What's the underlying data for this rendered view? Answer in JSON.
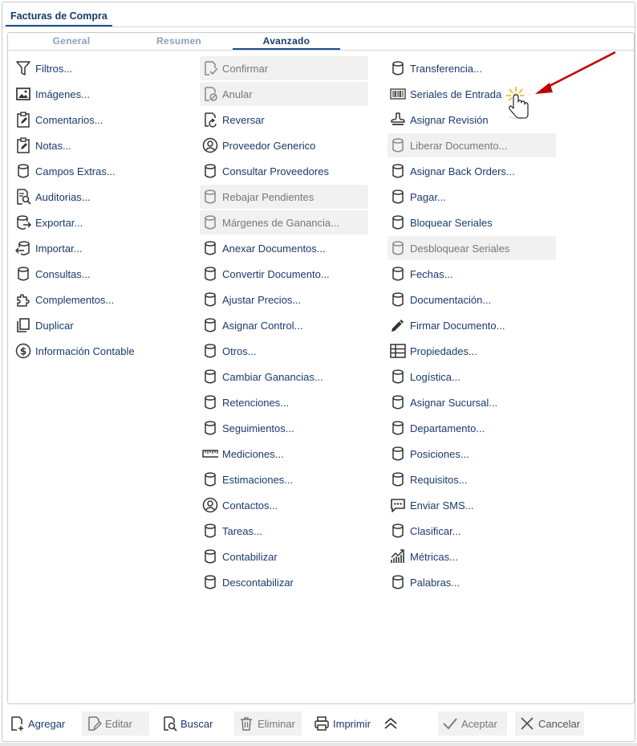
{
  "window": {
    "title": "Facturas de Compra"
  },
  "tabs": [
    {
      "label": "General",
      "active": false
    },
    {
      "label": "Resumen",
      "active": false
    },
    {
      "label": "Avanzado",
      "active": true
    }
  ],
  "col1": [
    {
      "label": "Filtros...",
      "icon": "filter-icon"
    },
    {
      "label": "Imágenes...",
      "icon": "image-icon"
    },
    {
      "label": "Comentarios...",
      "icon": "clipboard-edit-icon"
    },
    {
      "label": "Notas...",
      "icon": "clipboard-edit-icon"
    },
    {
      "label": "Campos Extras...",
      "icon": "database-icon"
    },
    {
      "label": "Auditorias...",
      "icon": "audit-search-icon"
    },
    {
      "label": "Exportar...",
      "icon": "database-export-icon"
    },
    {
      "label": "Importar...",
      "icon": "database-import-icon"
    },
    {
      "label": "Consultas...",
      "icon": "database-icon"
    },
    {
      "label": "Complementos...",
      "icon": "puzzle-icon"
    },
    {
      "label": "Duplicar",
      "icon": "copy-icon"
    },
    {
      "label": "Información Contable",
      "icon": "dollar-circle-icon"
    }
  ],
  "col2": [
    {
      "label": "Confirmar",
      "icon": "doc-check-icon",
      "disabled": true
    },
    {
      "label": "Anular",
      "icon": "doc-cancel-icon",
      "disabled": true
    },
    {
      "label": "Reversar",
      "icon": "doc-reverse-icon"
    },
    {
      "label": "Proveedor Generico",
      "icon": "user-circle-icon"
    },
    {
      "label": "Consultar Proveedores",
      "icon": "database-icon"
    },
    {
      "label": "Rebajar Pendientes",
      "icon": "database-icon",
      "disabled": true
    },
    {
      "label": "Márgenes de Ganancia...",
      "icon": "database-icon",
      "disabled": true
    },
    {
      "label": "Anexar Documentos...",
      "icon": "database-icon"
    },
    {
      "label": "Convertir Documento...",
      "icon": "database-icon"
    },
    {
      "label": "Ajustar Precios...",
      "icon": "database-icon"
    },
    {
      "label": "Asignar Control...",
      "icon": "database-icon"
    },
    {
      "label": "Otros...",
      "icon": "database-icon"
    },
    {
      "label": "Cambiar Ganancias...",
      "icon": "database-icon"
    },
    {
      "label": "Retenciones...",
      "icon": "database-icon"
    },
    {
      "label": "Seguimientos...",
      "icon": "database-icon"
    },
    {
      "label": "Mediciones...",
      "icon": "ruler-icon"
    },
    {
      "label": "Estimaciones...",
      "icon": "database-icon"
    },
    {
      "label": "Contactos...",
      "icon": "user-circle-icon"
    },
    {
      "label": "Tareas...",
      "icon": "database-icon"
    },
    {
      "label": "Contabilizar",
      "icon": "database-icon"
    },
    {
      "label": "Descontabilizar",
      "icon": "database-icon"
    }
  ],
  "col3": [
    {
      "label": "Transferencia...",
      "icon": "database-icon"
    },
    {
      "label": "Seriales de Entrada",
      "icon": "barcode-icon"
    },
    {
      "label": "Asignar Revisión",
      "icon": "stamp-icon"
    },
    {
      "label": "Liberar Documento...",
      "icon": "database-icon",
      "disabled": true
    },
    {
      "label": "Asignar Back Orders...",
      "icon": "database-icon"
    },
    {
      "label": "Pagar...",
      "icon": "database-icon"
    },
    {
      "label": "Bloquear Seriales",
      "icon": "database-icon"
    },
    {
      "label": "Desbloquear Seriales",
      "icon": "database-icon",
      "disabled": true
    },
    {
      "label": "Fechas...",
      "icon": "database-icon"
    },
    {
      "label": "Documentación...",
      "icon": "database-icon"
    },
    {
      "label": "Firmar Documento...",
      "icon": "pen-icon"
    },
    {
      "label": "Propiedades...",
      "icon": "properties-icon"
    },
    {
      "label": "Logística...",
      "icon": "database-icon"
    },
    {
      "label": "Asignar Sucursal...",
      "icon": "database-icon"
    },
    {
      "label": "Departamento...",
      "icon": "database-icon"
    },
    {
      "label": "Posiciones...",
      "icon": "database-icon"
    },
    {
      "label": "Requisitos...",
      "icon": "database-icon"
    },
    {
      "label": "Enviar SMS...",
      "icon": "chat-icon"
    },
    {
      "label": "Clasificar...",
      "icon": "database-icon"
    },
    {
      "label": "Métricas...",
      "icon": "chart-up-icon"
    },
    {
      "label": "Palabras...",
      "icon": "database-icon"
    }
  ],
  "toolbar": {
    "add": "Agregar",
    "edit": "Editar",
    "search": "Buscar",
    "delete": "Eliminar",
    "print": "Imprimir",
    "accept": "Aceptar",
    "cancel": "Cancelar"
  }
}
